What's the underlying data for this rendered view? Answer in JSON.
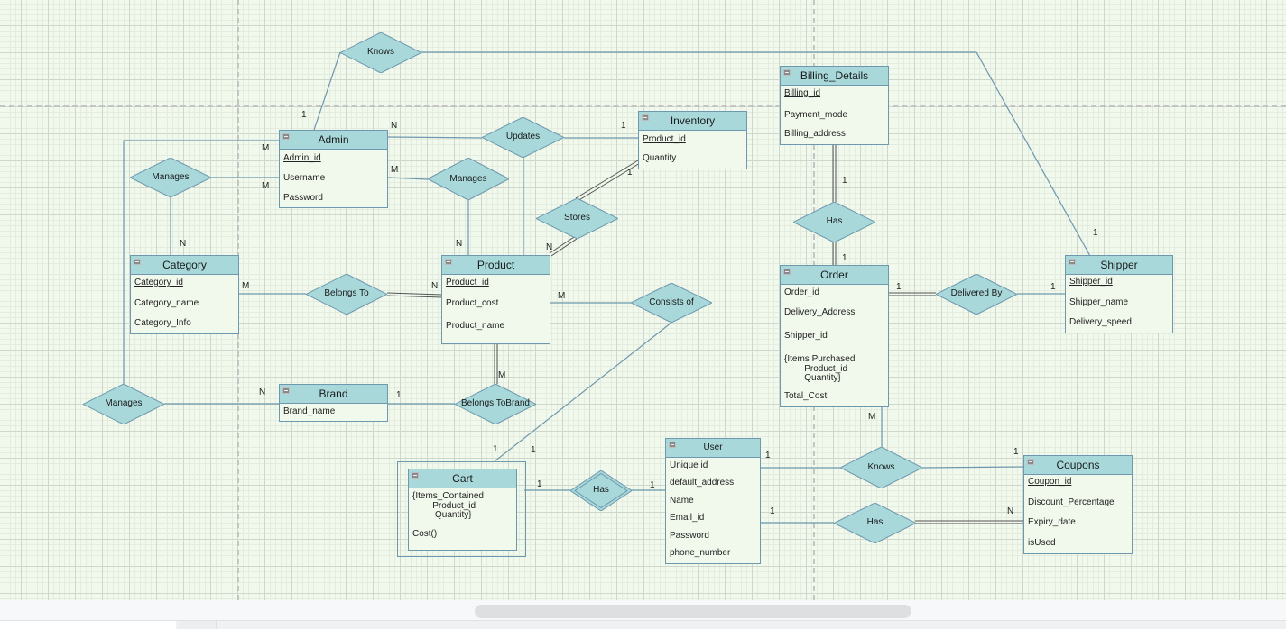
{
  "diagram": {
    "type": "ER diagram",
    "colors": {
      "entity_header": "#a8d8da",
      "relationship_fill": "#a8d8da",
      "border": "#6d98ad",
      "canvas": "#f1f8ec",
      "double_line": "#555555"
    },
    "entities": {
      "admin": {
        "title": "Admin",
        "attributes": [
          {
            "text": "Admin_id",
            "key": true
          },
          {
            "text": "Username"
          },
          {
            "text": "Password"
          }
        ]
      },
      "inventory": {
        "title": "Inventory",
        "attributes": [
          {
            "text": "Product_id",
            "key": true
          },
          {
            "text": "Quantity"
          }
        ]
      },
      "billing": {
        "title": "Billing_Details",
        "attributes": [
          {
            "text": "Billing_id",
            "key": true
          },
          {
            "text": "Payment_mode"
          },
          {
            "text": "Billing_address"
          }
        ]
      },
      "category": {
        "title": "Category",
        "attributes": [
          {
            "text": "Category_id",
            "key": true
          },
          {
            "text": "Category_name"
          },
          {
            "text": "Category_Info"
          }
        ]
      },
      "product": {
        "title": "Product",
        "attributes": [
          {
            "text": "Product_id",
            "key": true
          },
          {
            "text": "Product_cost"
          },
          {
            "text": "Product_name"
          }
        ]
      },
      "order": {
        "title": "Order",
        "attributes": [
          {
            "text": "Order_id",
            "key": true
          },
          {
            "text": "Delivery_Address"
          },
          {
            "text": "Shipper_id"
          },
          {
            "text": "{Items Purchased\n        Product_id\n        Quantity}"
          },
          {
            "text": "Total_Cost"
          }
        ]
      },
      "shipper": {
        "title": "Shipper",
        "attributes": [
          {
            "text": "Shipper_id",
            "key": true
          },
          {
            "text": "Shipper_name"
          },
          {
            "text": "Delivery_speed"
          }
        ]
      },
      "brand": {
        "title": "Brand",
        "attributes": [
          {
            "text": "Brand_name"
          }
        ]
      },
      "cart": {
        "title": "Cart",
        "weak": true,
        "attributes": [
          {
            "text": "{Items_Contained\n        Product_id\n         Quantity}"
          },
          {
            "text": "Cost()"
          }
        ]
      },
      "user": {
        "title": "User",
        "attributes": [
          {
            "text": "Unique id",
            "key": true
          },
          {
            "text": "default_address"
          },
          {
            "text": "Name"
          },
          {
            "text": "Email_id"
          },
          {
            "text": "Password"
          },
          {
            "text": "phone_number"
          }
        ]
      },
      "coupons": {
        "title": "Coupons",
        "attributes": [
          {
            "text": "Coupon_id",
            "key": true
          },
          {
            "text": "Discount_Percentage"
          },
          {
            "text": "Expiry_date"
          },
          {
            "text": "isUsed"
          }
        ]
      }
    },
    "relationships": {
      "knows_top": "Knows",
      "updates": "Updates",
      "manages_cat": "Manages",
      "manages_prod": "Manages",
      "stores": "Stores",
      "belongs_to": "Belongs To",
      "consists_of": "Consists of",
      "manages_brand": "Manages",
      "belongs_to_brand": "Belongs ToBrand",
      "has_billing": "Has",
      "delivered_by": "Delivered By",
      "has_cart": "Has",
      "knows_coupon": "Knows",
      "has_coupon": "Has"
    },
    "cardinalities": {
      "knows_admin": "1",
      "admin_updates": "N",
      "inventory_updates": "1",
      "admin_manages_cat_top": "M",
      "admin_manages_cat": "M",
      "category_manages": "N",
      "admin_manages_prod": "M",
      "product_manages": "N",
      "inventory_stores": "1",
      "product_stores": "N",
      "category_belongs": "M",
      "product_belongs": "N",
      "product_consists": "M",
      "product_brand": "M",
      "brand_manages": "N",
      "brand_belongs": "1",
      "cart_consists_a": "1",
      "cart_consists_b": "1",
      "cart_has": "1",
      "user_has": "1",
      "billing_has": "1",
      "order_has": "1",
      "order_delivered": "1",
      "shipper_delivered": "1",
      "shipper_knows": "1",
      "order_knows": "M",
      "user_knows": "1",
      "coupon_knows": "1",
      "user_has_coupon": "1",
      "coupon_has": "N"
    }
  },
  "scrollbar": {
    "horizontal_position": 0.37
  }
}
